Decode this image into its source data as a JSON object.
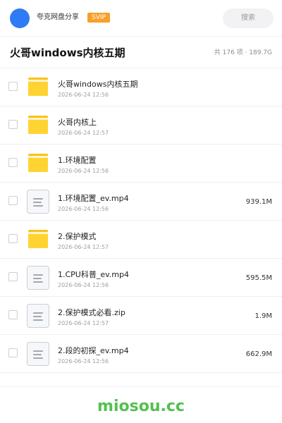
{
  "header": {
    "user_name": "夸克网盘分享",
    "badge": "SVIP",
    "search_placeholder": "搜索"
  },
  "folder": {
    "title": "火哥windows内核五期",
    "summary": "共 176 项 · 189.7G"
  },
  "items": [
    {
      "type": "folder",
      "name": "火哥windows内核五期",
      "date": "2026-06-24 12:56",
      "size": ""
    },
    {
      "type": "folder",
      "name": "火哥内核上",
      "date": "2026-06-24 12:57",
      "size": ""
    },
    {
      "type": "folder",
      "name": "1.环境配置",
      "date": "2026-06-24 12:56",
      "size": ""
    },
    {
      "type": "file",
      "name": "1.环境配置_ev.mp4",
      "date": "2026-06-24 12:56",
      "size": "939.1M"
    },
    {
      "type": "folder",
      "name": "2.保护模式",
      "date": "2026-06-24 12:57",
      "size": ""
    },
    {
      "type": "file",
      "name": "1.CPU科普_ev.mp4",
      "date": "2026-06-24 12:56",
      "size": "595.5M"
    },
    {
      "type": "file",
      "name": "2.保护模式必看.zip",
      "date": "2026-06-24 12:57",
      "size": "1.9M"
    },
    {
      "type": "file",
      "name": "2.段的初探_ev.mp4",
      "date": "2026-06-24 12:56",
      "size": "662.9M"
    }
  ],
  "icons": {
    "folder": "folder-icon",
    "file": "file-icon"
  },
  "colors": {
    "avatar": "#2f7bf6",
    "badge": "#f7a02b",
    "folder": "#ffd332",
    "watermark": "#52c14e"
  },
  "watermark": "miosou.cc"
}
